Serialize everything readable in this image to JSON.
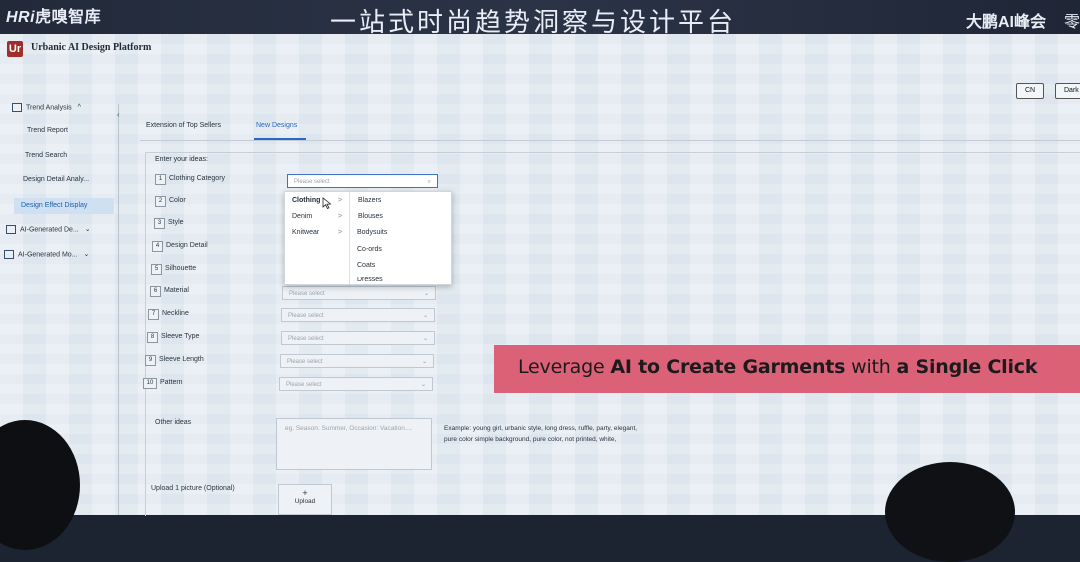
{
  "banner": {
    "brand_left_prefix": "",
    "brand_left_hri": "HRi",
    "brand_left_name": "虎嗅智库",
    "event_title": "一站式时尚趋势洞察与设计平台",
    "brand_right": "大鹏AI峰会",
    "brand_right_2": "零"
  },
  "app": {
    "logo_letters": "Ur",
    "title": "Urbanic AI Design Platform",
    "lang_button": "CN",
    "theme_button": "Dark"
  },
  "sidebar": {
    "items": [
      {
        "label": "Trend Analysis",
        "icon": "chart-icon",
        "chevron": "^"
      },
      {
        "label": "Trend Report"
      },
      {
        "label": "Trend Search"
      },
      {
        "label": "Design Detail Analy..."
      },
      {
        "label": "Design Effect Display"
      },
      {
        "label": "AI-Generated De...",
        "icon": "gear-icon",
        "chevron": "⌄"
      },
      {
        "label": "AI-Generated Mo...",
        "icon": "model-icon",
        "chevron": "⌄"
      }
    ],
    "collapse": "‹"
  },
  "tabs": [
    {
      "label": "Extension of Top Sellers"
    },
    {
      "label": "New Designs"
    }
  ],
  "form": {
    "section_label": "Enter your ideas:",
    "fields": [
      {
        "num": "1",
        "label": "Clothing Category",
        "placeholder": "Please select"
      },
      {
        "num": "2",
        "label": "Color"
      },
      {
        "num": "3",
        "label": "Style"
      },
      {
        "num": "4",
        "label": "Design Detail"
      },
      {
        "num": "5",
        "label": "Silhouette"
      },
      {
        "num": "6",
        "label": "Material",
        "placeholder": "Please select"
      },
      {
        "num": "7",
        "label": "Neckline",
        "placeholder": "Please select"
      },
      {
        "num": "8",
        "label": "Sleeve Type",
        "placeholder": "Please select"
      },
      {
        "num": "9",
        "label": "Sleeve Length",
        "placeholder": "Please select"
      },
      {
        "num": "10",
        "label": "Pattern",
        "placeholder": "Please select"
      }
    ],
    "other_label": "Other ideas",
    "other_placeholder": "eg. Season: Summer, Occasion: Vacation....",
    "example_text": "Example: young girl, urbanic style, long dress, ruffle, party, elegant, pure color simple background, pure color, not printed, white,",
    "upload_label": "Upload 1 picture (Optional)",
    "upload_plus": "+",
    "upload_button": "Upload"
  },
  "dropdown": {
    "categories": [
      {
        "label": "Clothing",
        "arrow": ">"
      },
      {
        "label": "Denim",
        "arrow": ">"
      },
      {
        "label": "Knitwear",
        "arrow": ">"
      }
    ],
    "subitems": [
      "Blazers",
      "Blouses",
      "Bodysuits",
      "Co-ords",
      "Coats",
      "Dresses"
    ]
  },
  "promo": {
    "part1": "Leverage ",
    "part2": "AI to Create Garments",
    "part3": " with ",
    "part4": "a Single Click"
  },
  "colors": {
    "accent": "#2a67c2",
    "logo": "#a12d2a",
    "promo_bg": "#d9566e"
  }
}
